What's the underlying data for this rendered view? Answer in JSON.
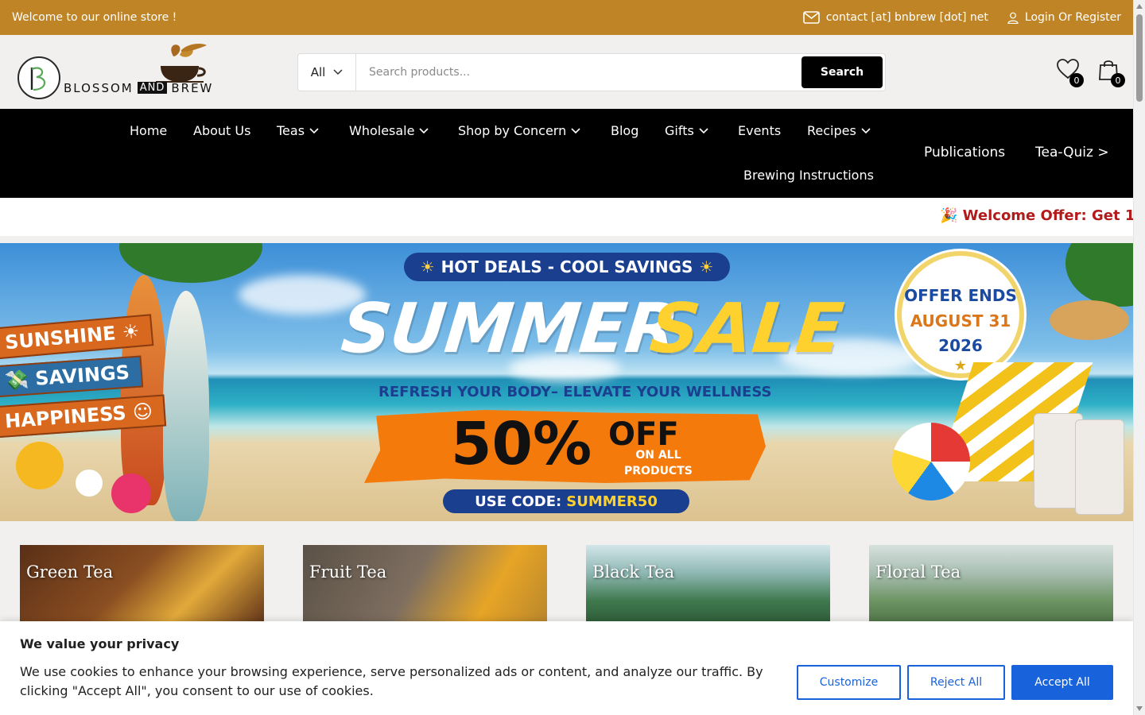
{
  "topbar": {
    "welcome": "Welcome to our online store !",
    "contact": "contact [at] bnbrew [dot] net",
    "login": "Login Or Register"
  },
  "logo": {
    "word1": "BLOSSOM",
    "word2": "AND",
    "word3": "BREW"
  },
  "search": {
    "category": "All",
    "placeholder": "Search products...",
    "button": "Search"
  },
  "header_icons": {
    "wishlist_count": "0",
    "cart_count": "0"
  },
  "nav": {
    "home": "Home",
    "about": "About Us",
    "teas": "Teas",
    "wholesale": "Wholesale",
    "shop_by_concern": "Shop by Concern",
    "blog": "Blog",
    "gifts": "Gifts",
    "events": "Events",
    "recipes": "Recipes",
    "brewing": "Brewing Instructions",
    "publications": "Publications",
    "tea_quiz": "Tea-Quiz >"
  },
  "offer_strip": {
    "text": "🎉 Welcome Offer: Get 1"
  },
  "banner": {
    "hot_deals": "HOT DEALS - COOL SAVINGS",
    "summer": "SUMMER",
    "sale": "SALE",
    "refresh": "REFRESH YOUR BODY– ELEVATE YOUR WELLNESS",
    "percent": "50%",
    "off": "OFF",
    "on_all": "ON ALL",
    "products": "PRODUCTS",
    "code_label": "USE CODE:",
    "code": "SUMMER50",
    "offer_ends": "OFFER ENDS",
    "date": "AUGUST 31",
    "year": "2026",
    "sign1": "SUNSHINE ☀",
    "sign2": "💸 SAVINGS",
    "sign3": "HAPPINESS ☺"
  },
  "categories": [
    {
      "label": "Green Tea"
    },
    {
      "label": "Fruit Tea"
    },
    {
      "label": "Black Tea"
    },
    {
      "label": "Floral Tea"
    }
  ],
  "cookie": {
    "title": "We value your privacy",
    "body": "We use cookies to enhance your browsing experience, serve personalized ads or content, and analyze our traffic. By clicking \"Accept All\", you consent to our use of cookies.",
    "customize": "Customize",
    "reject": "Reject All",
    "accept": "Accept All"
  },
  "colors": {
    "topbar": "#bf8426",
    "nav": "#000000",
    "offer_red": "#b11b1b",
    "cookie_blue": "#1863dc"
  }
}
